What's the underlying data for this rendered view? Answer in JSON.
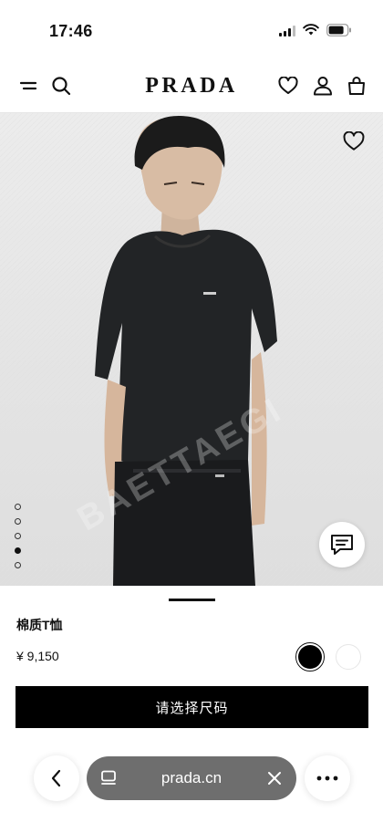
{
  "status_bar": {
    "time": "17:46"
  },
  "header": {
    "logo": "PRADA"
  },
  "hero": {
    "watermark": "BAETTAEGI",
    "total_images": 5,
    "active_image_index": 3
  },
  "product": {
    "name": "棉质T恤",
    "price": "¥ 9,150"
  },
  "colors": {
    "selected_swatch": "#000000",
    "other_swatch": "#ffffff",
    "cta_background": "#000000",
    "url_bar_background": "#6e6e6e"
  },
  "cta": {
    "label": "请选择尺码"
  },
  "browser": {
    "url": "prada.cn"
  },
  "icons": {
    "menu": "menu-icon",
    "search": "search-icon",
    "wishlist": "heart-icon",
    "account": "user-icon",
    "bag": "bag-icon",
    "chat": "chat-icon",
    "back": "chevron-left-icon",
    "tabs": "tabs-icon",
    "close": "close-icon",
    "more": "more-icon"
  }
}
